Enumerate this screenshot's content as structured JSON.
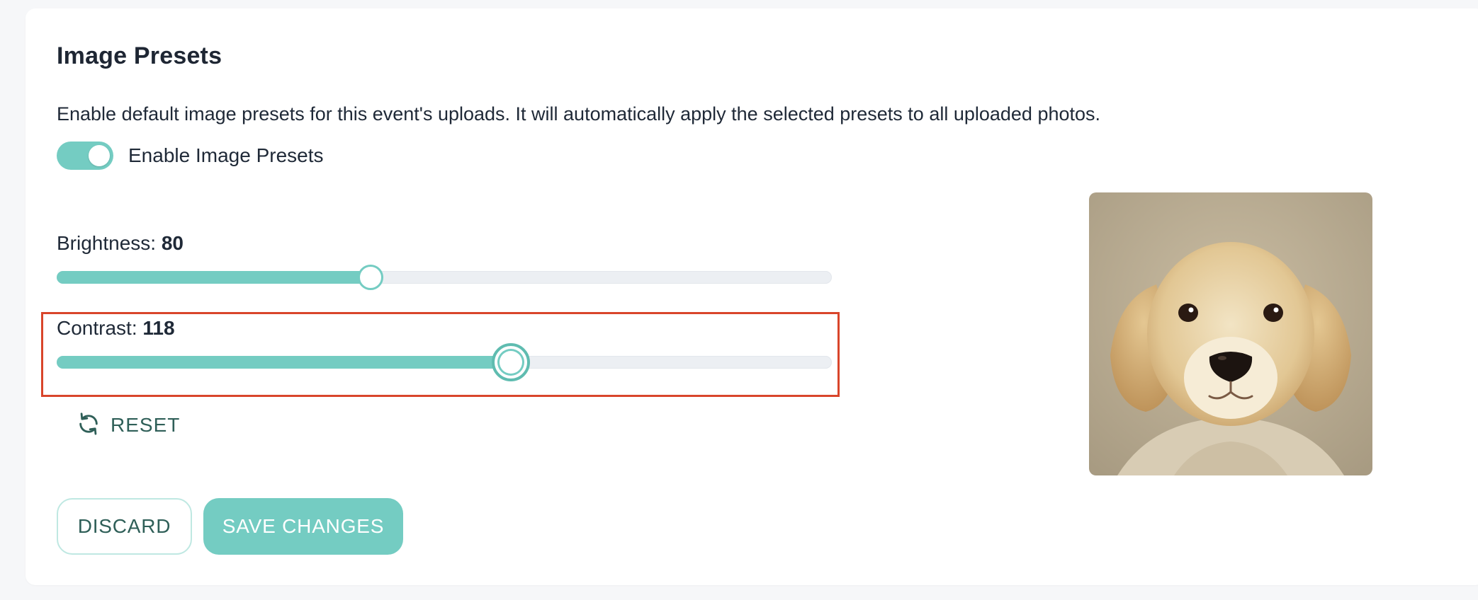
{
  "panel": {
    "title": "Image Presets",
    "description": "Enable default image presets for this event's uploads. It will automatically apply the selected presets to all uploaded photos."
  },
  "toggle": {
    "label": "Enable Image Presets",
    "enabled": true
  },
  "brightness": {
    "label": "Brightness: ",
    "value": "80",
    "fraction": 0.405
  },
  "contrast": {
    "label": "Contrast: ",
    "value": "118",
    "fraction": 0.586
  },
  "reset": {
    "label": "RESET",
    "icon": "refresh-icon"
  },
  "buttons": {
    "discard": "DISCARD",
    "save": "SAVE CHANGES"
  },
  "preview": {
    "subject": "golden retriever puppy"
  },
  "colors": {
    "accent": "#74ccc2",
    "track": "#eceff3",
    "highlight": "#d9452b",
    "text_dark": "#1f2937",
    "button_text": "#2f5f58"
  }
}
